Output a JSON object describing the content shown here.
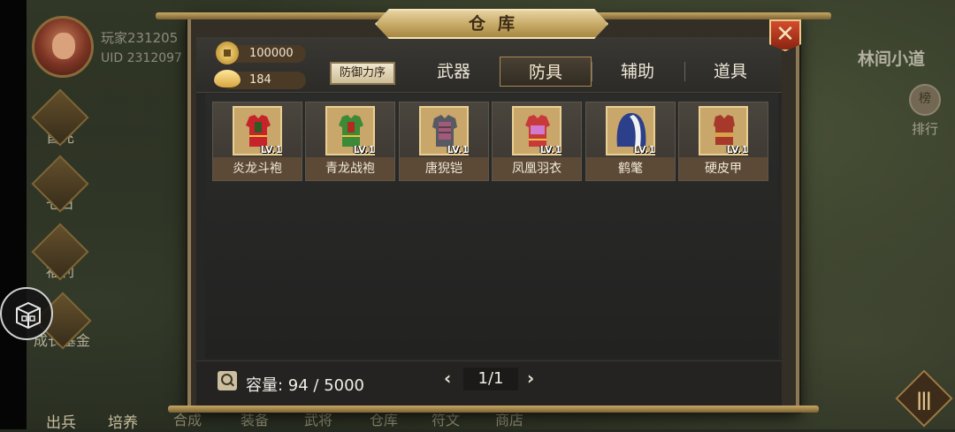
{
  "player": {
    "name": "玩家231205",
    "uid": "UID  2312097"
  },
  "left_menu": [
    {
      "label": "首充",
      "icon": "gift-icon"
    },
    {
      "label": "七日",
      "icon": "scroll-icon"
    },
    {
      "label": "福利",
      "icon": "treasure-icon"
    },
    {
      "label": "成长基金",
      "icon": "coin-icon"
    }
  ],
  "right": {
    "area_name": "林间小道",
    "rank_label": "排行",
    "rank_badge": "榜"
  },
  "bottom_nav": [
    {
      "label": "出兵"
    },
    {
      "label": "培养"
    },
    {
      "label": "合成"
    },
    {
      "label": "装备"
    },
    {
      "label": "武将"
    },
    {
      "label": "仓库"
    },
    {
      "label": "符文"
    },
    {
      "label": "商店"
    }
  ],
  "warehouse": {
    "title": "仓库",
    "close_icon": "close-icon",
    "copper": "100000",
    "gold": "184",
    "sort_label": "防御力序",
    "tabs": [
      {
        "label": "武器",
        "active": false
      },
      {
        "label": "防具",
        "active": true
      },
      {
        "label": "辅助",
        "active": false
      },
      {
        "label": "道具",
        "active": false
      }
    ],
    "items": [
      {
        "name": "炎龙斗袍",
        "level": "LV.1",
        "icon": "armor-robe-icon",
        "color": "#c6242a",
        "accent": "#2f5a22"
      },
      {
        "name": "青龙战袍",
        "level": "LV.1",
        "icon": "armor-robe-icon",
        "color": "#3d8a36",
        "accent": "#b12a22"
      },
      {
        "name": "唐猊铠",
        "level": "LV.1",
        "icon": "armor-plate-icon",
        "color": "#a4587a",
        "accent": "#575a63"
      },
      {
        "name": "凤凰羽衣",
        "level": "LV.1",
        "icon": "armor-robe-icon",
        "color": "#c83a3a",
        "accent": "#d07ad0"
      },
      {
        "name": "鹤氅",
        "level": "LV.1",
        "icon": "cloak-icon",
        "color": "#2b3f8a",
        "accent": "#f1f1f1"
      },
      {
        "name": "硬皮甲",
        "level": "LV.1",
        "icon": "leather-armor-icon",
        "color": "#a6392a",
        "accent": "#d8a24a"
      }
    ],
    "capacity_label": "容量: 94 / 5000",
    "page": "1/1"
  }
}
